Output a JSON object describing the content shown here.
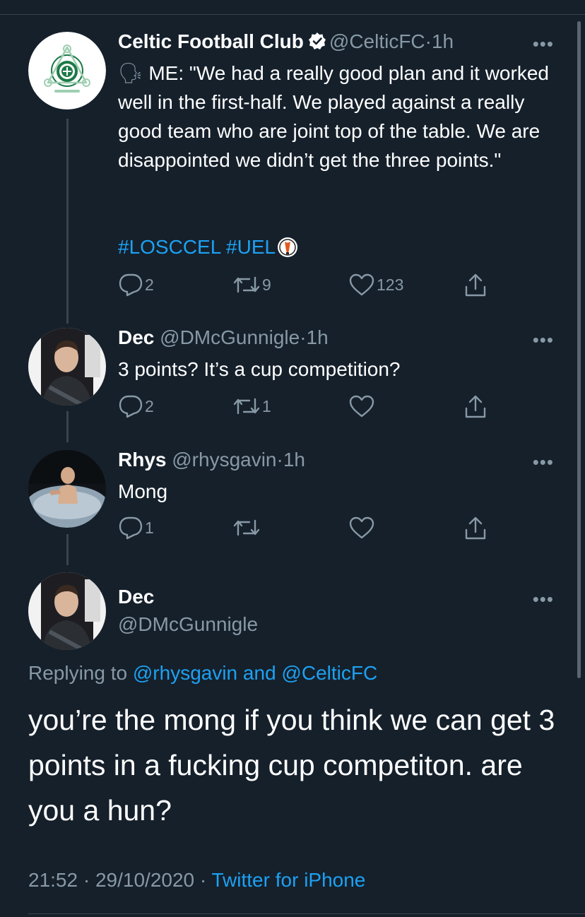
{
  "tweet_celtic": {
    "name": "Celtic Football Club",
    "handle": "@CelticFC",
    "dot": "·",
    "time": "1h",
    "more": "•••",
    "speaker_emoji": "🗣",
    "text": " ME: \"We had a really good plan and it worked well in the first-half. We played against a really good team who are joint top of the table. We are disappointed we didn’t get the three points.\"",
    "hashtag1": "#LOSCCEL",
    "hashtag2": "#UEL",
    "replies": "2",
    "retweets": "9",
    "likes": "123"
  },
  "reply_dec": {
    "name": "Dec",
    "handle": "@DMcGunnigle",
    "dot": "·",
    "time": "1h",
    "more": "•••",
    "text": "3 points? It’s a cup competition?",
    "replies": "2",
    "retweets": "1"
  },
  "reply_rhys": {
    "name": "Rhys",
    "handle": "@rhysgavin",
    "dot": "·",
    "time": "1h",
    "more": "•••",
    "text": "Mong",
    "replies": "1"
  },
  "main_tweet": {
    "name": "Dec",
    "handle": "@DMcGunnigle",
    "more": "•••",
    "replying_prefix": "Replying to ",
    "replying_user1": "@rhysgavin",
    "replying_and": " and ",
    "replying_user2": "@CelticFC",
    "text": "you’re the mong if you think we can get 3 points in a fucking cup competiton. are you a hun?",
    "time": "21:52",
    "sep1": " · ",
    "date": "29/10/2020",
    "sep2": " · ",
    "source": "Twitter for iPhone"
  },
  "colors": {
    "background": "#15202b",
    "link": "#1da1f2",
    "muted": "#8899a6",
    "divider": "#38444d"
  }
}
